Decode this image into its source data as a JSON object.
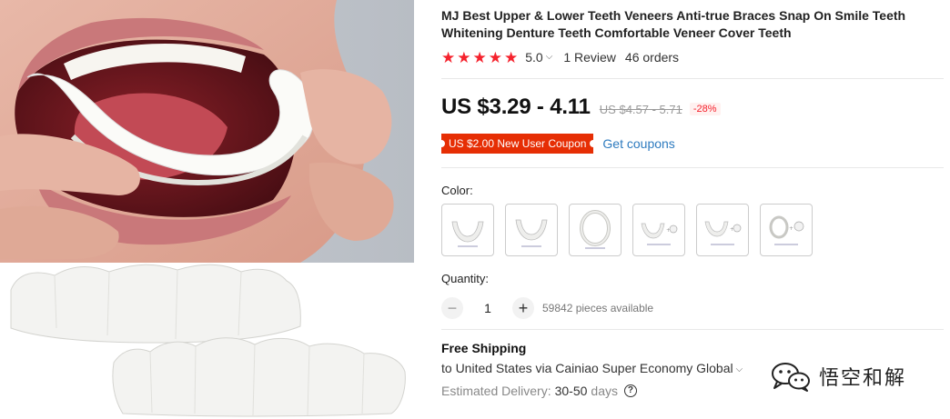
{
  "product": {
    "title": "MJ Best Upper & Lower Teeth Veneers Anti-true Braces Snap On Smile Teeth Whitening Denture Teeth Comfortable Veneer Cover Teeth",
    "rating": "5.0",
    "reviews": "1 Review",
    "orders": "46 orders",
    "star_count": 5,
    "star_color": "#f5222d"
  },
  "price": {
    "current": "US $3.29 - 4.11",
    "original": "US $4.57 - 5.71",
    "discount": "-28%"
  },
  "coupon": {
    "badge": "US $2.00 New User Coupon",
    "link": "Get coupons",
    "badge_color": "#e62e04",
    "link_color": "#2e7bbf"
  },
  "color": {
    "label": "Color:",
    "options": [
      {
        "name": "Upper Teeth"
      },
      {
        "name": "Lower Teeth"
      },
      {
        "name": "Upper + Lower Teeth"
      },
      {
        "name": "Upper Teeth + Case"
      },
      {
        "name": "Lower Teeth + Case"
      },
      {
        "name": "Upper + Lower Teeth + Case"
      }
    ]
  },
  "quantity": {
    "label": "Quantity:",
    "value": "1",
    "minus": "−",
    "plus": "+",
    "available": "59842 pieces available"
  },
  "shipping": {
    "title": "Free Shipping",
    "destination": "to United States via Cainiao Super Economy Global",
    "estimated_label": "Estimated Delivery:",
    "estimated_value": "30-50",
    "estimated_unit": "days",
    "help": "?"
  },
  "watermark": {
    "text": "悟空和解"
  }
}
